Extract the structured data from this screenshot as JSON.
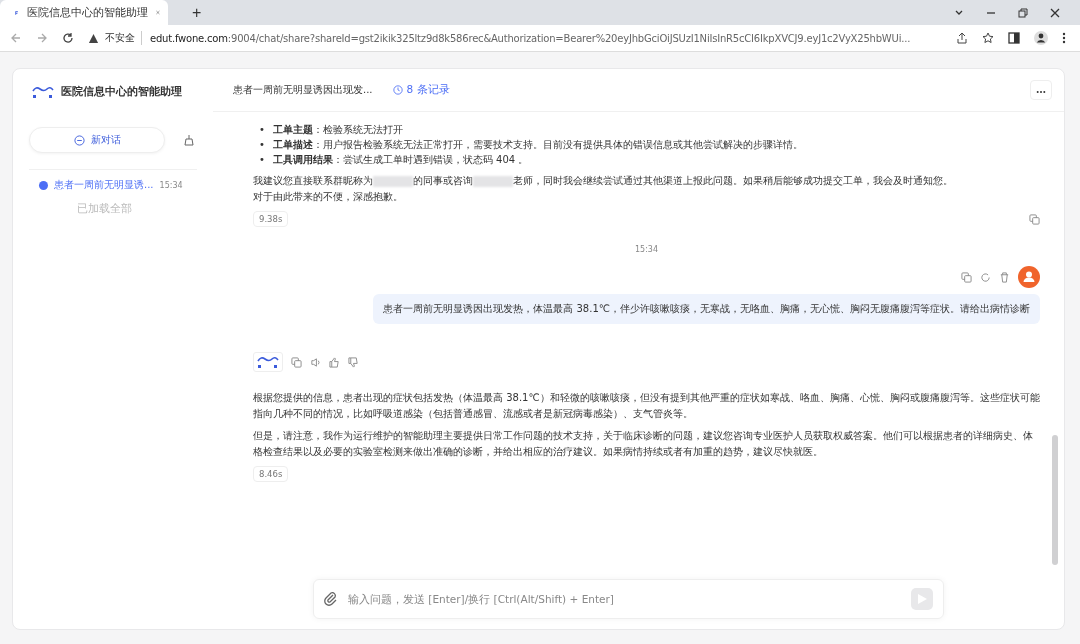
{
  "browser": {
    "tab_title": "医院信息中心的智能助理",
    "new_tab": "+",
    "security": "不安全",
    "url_host": "edut.fwone.com",
    "url_rest": ":9004/chat/share?shareId=gst2ikik325ltz9d8k586rec&Authorization=Bearer%20eyJhbGciOiJSUzI1NiIsInR5cCI6IkpXVCJ9.eyJ1c2VyX25hbWUi..."
  },
  "sidebar": {
    "app_name": "医院信息中心的智能助理",
    "new_chat": "新对话",
    "conversations": [
      {
        "title": "患者一周前无明显诱...",
        "time": "15:34",
        "selected": true
      }
    ],
    "loaded_all": "已加载全部"
  },
  "header": {
    "title": "患者一周前无明显诱因出现发...",
    "records": "8 条记录"
  },
  "messages": [
    {
      "kind": "assistant",
      "bullets": [
        {
          "marker": "•",
          "label": "工单主题",
          "text": "：检验系统无法打开"
        },
        {
          "marker": "•",
          "label": "工单描述",
          "text": "：用户报告检验系统无法正常打开，需要技术支持。目前没有提供具体的错误信息或其他尝试解决的步骤详情。"
        },
        {
          "marker": "•",
          "label": "工具调用结果",
          "text": "：尝试生成工单时遇到错误，状态码 404 。"
        }
      ],
      "paragraphs": [
        {
          "parts": [
            {
              "kind": "text",
              "text": "我建议您直接联系群昵称为"
            },
            {
              "kind": "redacted"
            },
            {
              "kind": "text",
              "text": "的同事或咨询"
            },
            {
              "kind": "redacted"
            },
            {
              "kind": "text",
              "text": "老师，同时我会继续尝试通过其他渠道上报此问题。如果稍后能够成功提交工单，我会及时通知您。"
            },
            {
              "kind": "line",
              "text": "对于由此带来的不便，深感抱歉。"
            }
          ]
        }
      ],
      "duration": "9.38s",
      "toolbar": false
    },
    {
      "kind": "time",
      "text": "15:34"
    },
    {
      "kind": "user",
      "text": "患者一周前无明显诱因出现发热，体温最高 38.1℃，伴少许咳嗽咳痰，无寒战，无咯血、胸痛，无心慌、胸闷无腹痛腹泻等症状。请给出病情诊断"
    },
    {
      "kind": "assistant",
      "paragraphs": [
        {
          "parts": [
            {
              "kind": "line",
              "text": "根据您提供的信息，患者出现的症状包括发热（体温最高 38.1℃）和轻微的咳嗽咳痰，但没有提到其他严重的症状如寒战、咯血、胸痛、心慌、胸闷或腹痛腹泻等。这些症状可能指向几种不同的情况，比如呼吸道感染（包括普通感冒、流感或者是新冠病毒感染）、支气管炎等。"
            }
          ]
        },
        {
          "parts": [
            {
              "kind": "line",
              "text": "但是，请注意，我作为运行维护的智能助理主要提供日常工作问题的技术支持，关于临床诊断的问题，建议您咨询专业医护人员获取权威答案。他们可以根据患者的详细病史、体格检查结果以及必要的实验室检测来做出准确的诊断，并给出相应的治疗建议。如果病情持续或者有加重的趋势，建议尽快就医。"
            }
          ]
        }
      ],
      "duration": "8.46s",
      "toolbar": true
    }
  ],
  "input": {
    "placeholder": "输入问题，发送 [Enter]/换行 [Ctrl(Alt/Shift) + Enter]"
  }
}
